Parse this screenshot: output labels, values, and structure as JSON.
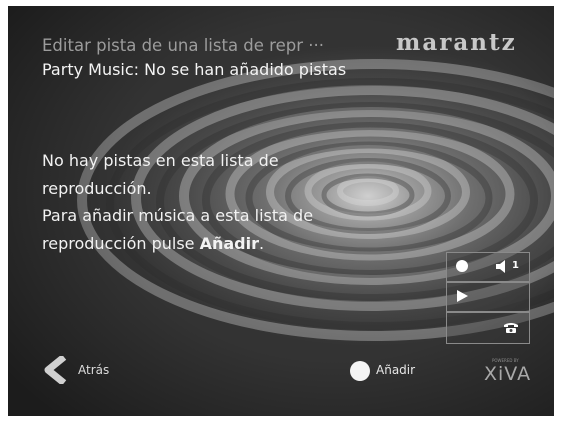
{
  "header": {
    "title": "Editar pista de una lista de repr ···",
    "brand": "marantz",
    "subtitle": "Party Music: No se han añadido pistas"
  },
  "message": {
    "line1": "No hay pistas en esta lista de",
    "line2": "reproducción.",
    "line3": "Para añadir música a esta lista de",
    "line4_prefix": "reproducción pulse ",
    "line4_bold": "Añadir",
    "line4_suffix": "."
  },
  "status_panel": {
    "volume_zone": "1",
    "icons": [
      "record-icon",
      "speaker-icon",
      "play-icon",
      "phone-icon"
    ]
  },
  "footer": {
    "back_label": "Atrás",
    "add_label": "Añadir",
    "xiva_logo": "XiVA",
    "xiva_tagline": "POWERED BY"
  },
  "colors": {
    "background": "#4a4a4a",
    "text_primary": "#f2f2f2",
    "text_secondary": "#9c9c9c"
  }
}
